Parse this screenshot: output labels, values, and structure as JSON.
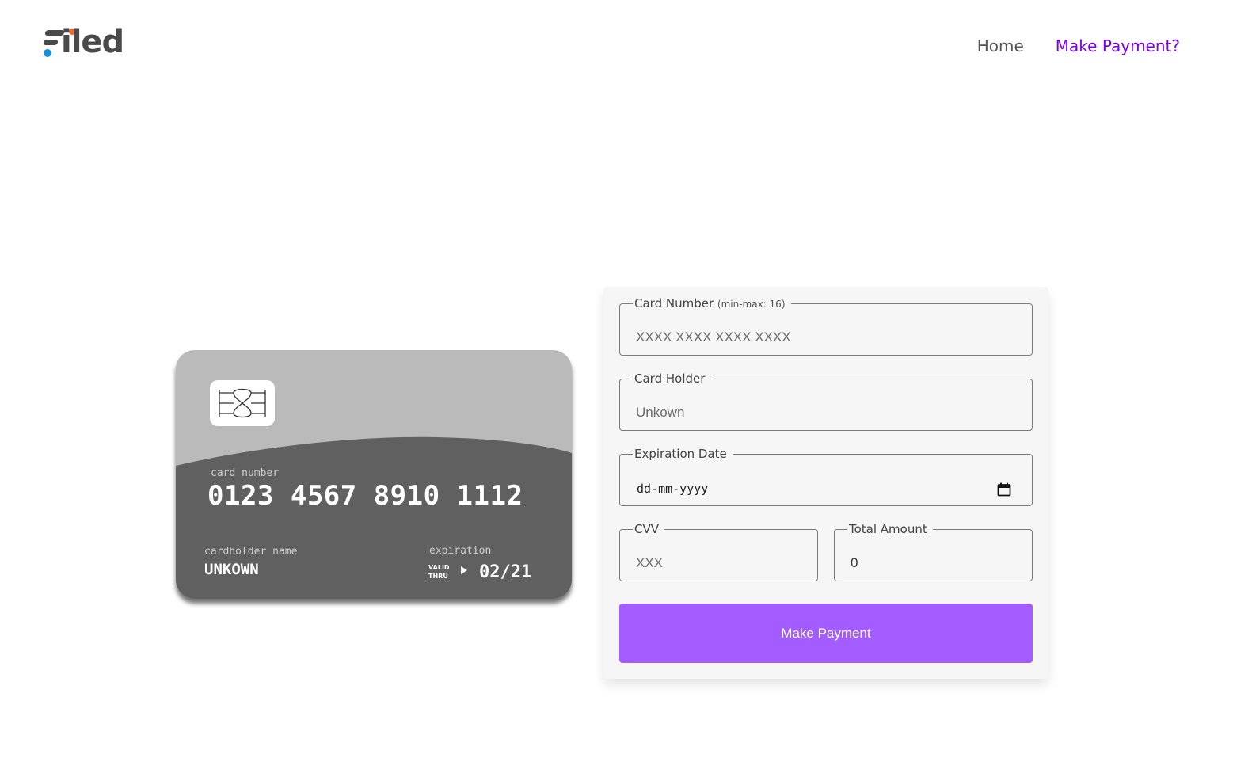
{
  "header": {
    "logo_text": "iled",
    "logo_full": "Filed",
    "nav": [
      {
        "label": "Home",
        "active": false
      },
      {
        "label": "Make Payment?",
        "active": true
      }
    ]
  },
  "card_preview": {
    "number_label": "card number",
    "number": "0123 4567 8910 1112",
    "holder_label": "cardholder name",
    "holder": "UNKOWN",
    "expiration_label": "expiration",
    "valid_thru_line1": "VALID",
    "valid_thru_line2": "THRU",
    "expiration": "02/21",
    "colors": {
      "top": "#bababa",
      "bottom": "#606060",
      "chip": "#ffffff"
    }
  },
  "form": {
    "card_number": {
      "label": "Card Number",
      "hint": "(min-max: 16)",
      "placeholder": "XXXX XXXX XXXX XXXX",
      "value": ""
    },
    "card_holder": {
      "label": "Card Holder",
      "placeholder": "Unkown",
      "value": ""
    },
    "expiration_date": {
      "label": "Expiration Date",
      "value": "dd-mm-yyyy",
      "icon": "calendar-icon"
    },
    "cvv": {
      "label": "CVV",
      "placeholder": "XXX",
      "value": ""
    },
    "total_amount": {
      "label": "Total Amount",
      "value": "0"
    },
    "submit_label": "Make Payment"
  },
  "colors": {
    "accent": "#7a00e6",
    "button": "#a25cff",
    "panel": "#f6f6f6",
    "brand_blue": "#1a8fd8",
    "brand_orange": "#f06a35"
  }
}
